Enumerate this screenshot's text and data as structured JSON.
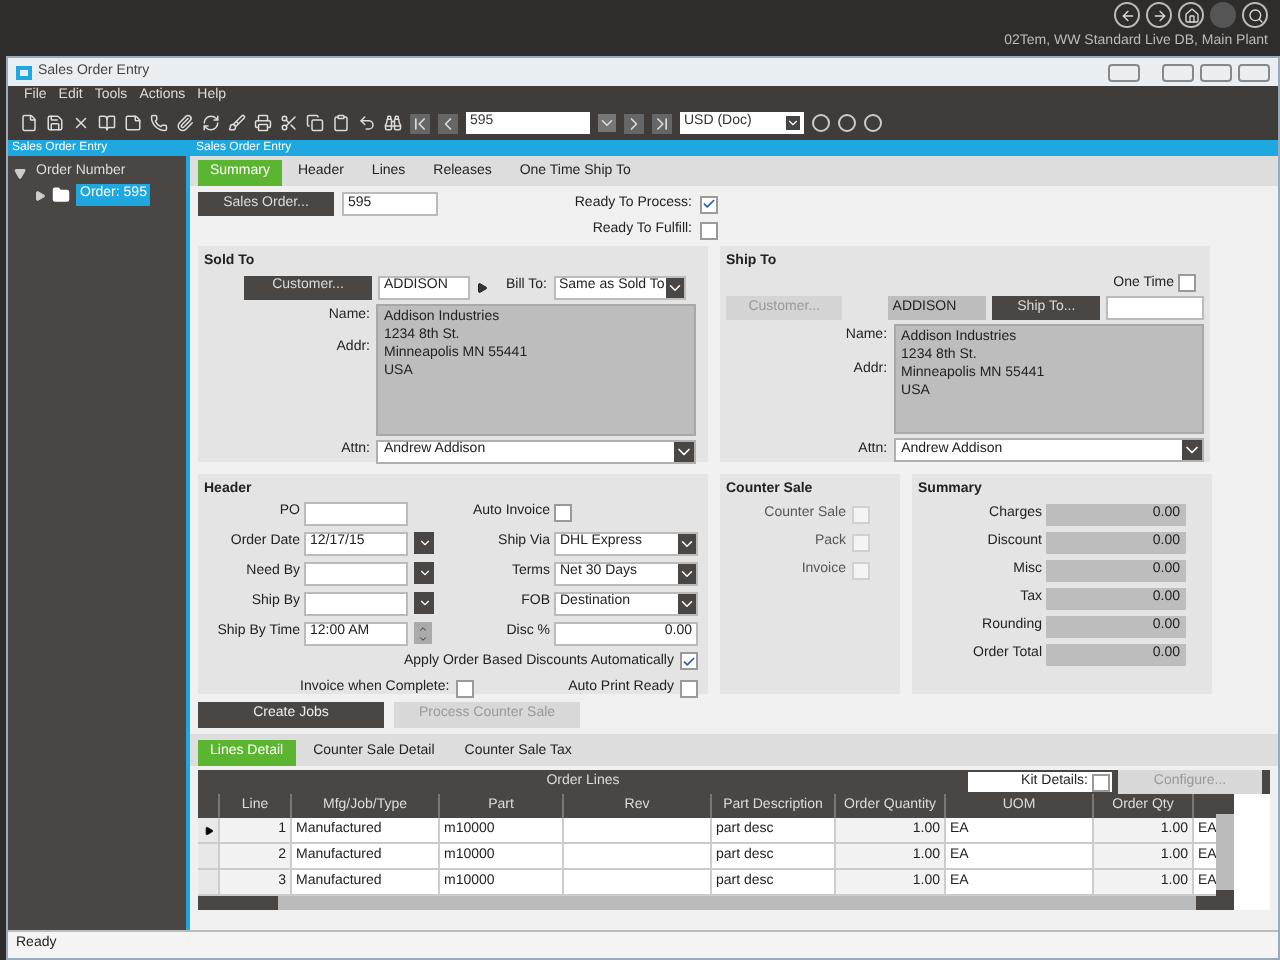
{
  "session": "02Tem, WW Standard Live DB, Main Plant",
  "window": {
    "title": "Sales Order Entry"
  },
  "menu": [
    "File",
    "Edit",
    "Tools",
    "Actions",
    "Help"
  ],
  "toolbar": {
    "order_field": "595",
    "currency": "USD (Doc)"
  },
  "left_panel": {
    "title": "Sales Order Entry",
    "tree": [
      {
        "label": "Order Number",
        "expanded": true,
        "children": [
          {
            "label": "Order: 595",
            "selected": true
          }
        ]
      }
    ]
  },
  "main_panel": {
    "title": "Sales Order Entry"
  },
  "tabs": [
    {
      "label": "Summary",
      "selected": true
    },
    {
      "label": "Header",
      "selected": false
    },
    {
      "label": "Lines",
      "selected": false
    },
    {
      "label": "Releases",
      "selected": false
    },
    {
      "label": "One Time Ship To",
      "selected": false
    }
  ],
  "order": {
    "button": "Sales Order...",
    "value": "595",
    "ready_to_process": {
      "label": "Ready To Process:",
      "checked": true
    },
    "ready_to_fulfill": {
      "label": "Ready To Fulfill:",
      "checked": false
    }
  },
  "sold_to": {
    "title": "Sold To",
    "customer_button": "Customer...",
    "customer": "ADDISON",
    "bill_to_label": "Bill To:",
    "bill_to": "Same as Sold To",
    "name_label": "Name:",
    "addr_label": "Addr:",
    "address": [
      "Addison Industries",
      "1234 8th St.",
      "Minneapolis MN 55441",
      "USA"
    ],
    "attn_label": "Attn:",
    "attn": "Andrew Addison"
  },
  "ship_to": {
    "title": "Ship To",
    "one_time": {
      "label": "One Time",
      "checked": false
    },
    "customer_button": {
      "label": "Customer...",
      "disabled": true
    },
    "customer": "ADDISON",
    "ship_to_button": "Ship To...",
    "name_label": "Name:",
    "addr_label": "Addr:",
    "address": [
      "Addison Industries",
      "1234 8th St.",
      "Minneapolis MN 55441",
      "USA"
    ],
    "attn_label": "Attn:",
    "attn": "Andrew Addison"
  },
  "header": {
    "title": "Header",
    "left_fields": [
      {
        "label": "PO",
        "kind": "text"
      },
      {
        "label": "Order Date",
        "value": "12/17/15",
        "kind": "date"
      },
      {
        "label": "Need By",
        "kind": "date"
      },
      {
        "label": "Ship By",
        "kind": "date"
      },
      {
        "label": "Ship By Time",
        "value": "12:00 AM",
        "kind": "time"
      }
    ],
    "right_fields": [
      {
        "label": "Auto Invoice",
        "kind": "check",
        "checked": false
      },
      {
        "label": "Ship Via",
        "value": "DHL Express",
        "kind": "select"
      },
      {
        "label": "Terms",
        "value": "Net 30 Days",
        "kind": "select"
      },
      {
        "label": "FOB",
        "value": "Destination",
        "kind": "select"
      },
      {
        "label": "Disc %",
        "value": "0.00",
        "kind": "number"
      }
    ],
    "apply_discounts": {
      "label": "Apply Order Based Discounts Automatically",
      "checked": true
    },
    "invoice_when_complete": {
      "label": "Invoice when Complete:",
      "checked": false
    },
    "auto_print_ready": {
      "label": "Auto Print Ready",
      "checked": false
    }
  },
  "counter_sale": {
    "title": "Counter Sale",
    "items": [
      {
        "label": "Counter Sale",
        "checked": false
      },
      {
        "label": "Pack",
        "checked": false
      },
      {
        "label": "Invoice",
        "checked": false
      }
    ]
  },
  "summary": {
    "title": "Summary",
    "rows": [
      {
        "label": "Charges",
        "value": "0.00"
      },
      {
        "label": "Discount",
        "value": "0.00"
      },
      {
        "label": "Misc",
        "value": "0.00"
      },
      {
        "label": "Tax",
        "value": "0.00"
      },
      {
        "label": "Rounding",
        "value": "0.00"
      },
      {
        "label": "Order Total",
        "value": "0.00"
      }
    ]
  },
  "actions": [
    {
      "label": "Create Jobs",
      "disabled": false
    },
    {
      "label": "Process Counter Sale",
      "disabled": true
    }
  ],
  "lower_tabs": [
    {
      "label": "Lines Detail",
      "selected": true
    },
    {
      "label": "Counter Sale Detail",
      "selected": false
    },
    {
      "label": "Counter Sale Tax",
      "selected": false
    }
  ],
  "grid": {
    "title": "Order Lines",
    "kit_details": {
      "label": "Kit Details:",
      "checked": false
    },
    "configure": {
      "label": "Configure...",
      "disabled": true
    },
    "columns": [
      "Line",
      "Mfg/Job/Type",
      "Part",
      "Rev",
      "Part Description",
      "Order Quantity",
      "UOM",
      "Order Qty"
    ],
    "rows": [
      {
        "current": true,
        "cells": [
          "1",
          "Manufactured",
          "m10000",
          null,
          "part desc",
          "1.00",
          "EA",
          "1.00",
          "EA"
        ]
      },
      {
        "current": false,
        "cells": [
          "2",
          "Manufactured",
          "m10000",
          null,
          "part desc",
          "1.00",
          "EA",
          "1.00",
          "EA"
        ]
      },
      {
        "current": false,
        "cells": [
          "3",
          "Manufactured",
          "m10000",
          null,
          "part desc",
          "1.00",
          "EA",
          "1.00",
          "EA"
        ]
      }
    ]
  },
  "status_bar": "Ready"
}
